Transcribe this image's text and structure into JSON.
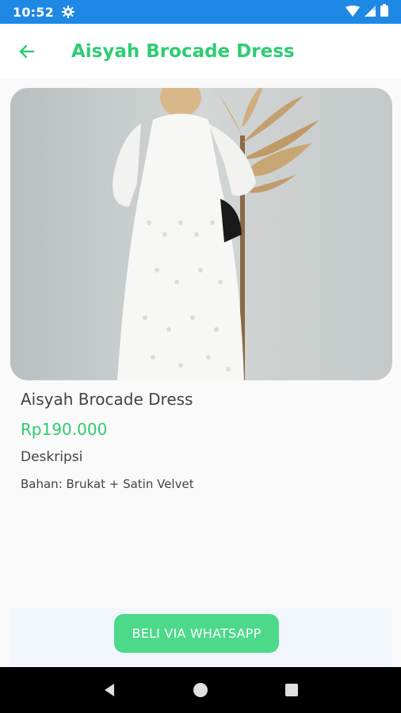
{
  "status_bar": {
    "time": "10:52",
    "icons": [
      "gear-icon",
      "wifi-icon",
      "signal-icon",
      "battery-icon"
    ]
  },
  "app_bar": {
    "back_icon": "arrow-left-icon",
    "title": "Aisyah Brocade Dress",
    "accent_color": "#2ecc71"
  },
  "product": {
    "image_description": "woman wearing white brocade dress",
    "name": "Aisyah Brocade Dress",
    "price": "Rp190.000",
    "description_label": "Deskripsi",
    "description": "Bahan: Brukat + Satin Velvet"
  },
  "actions": {
    "buy_label": "BELI VIA WHATSAPP",
    "button_color": "#4cd98a"
  },
  "nav_bar": {
    "buttons": [
      "back-triangle-icon",
      "home-circle-icon",
      "recents-square-icon"
    ]
  }
}
